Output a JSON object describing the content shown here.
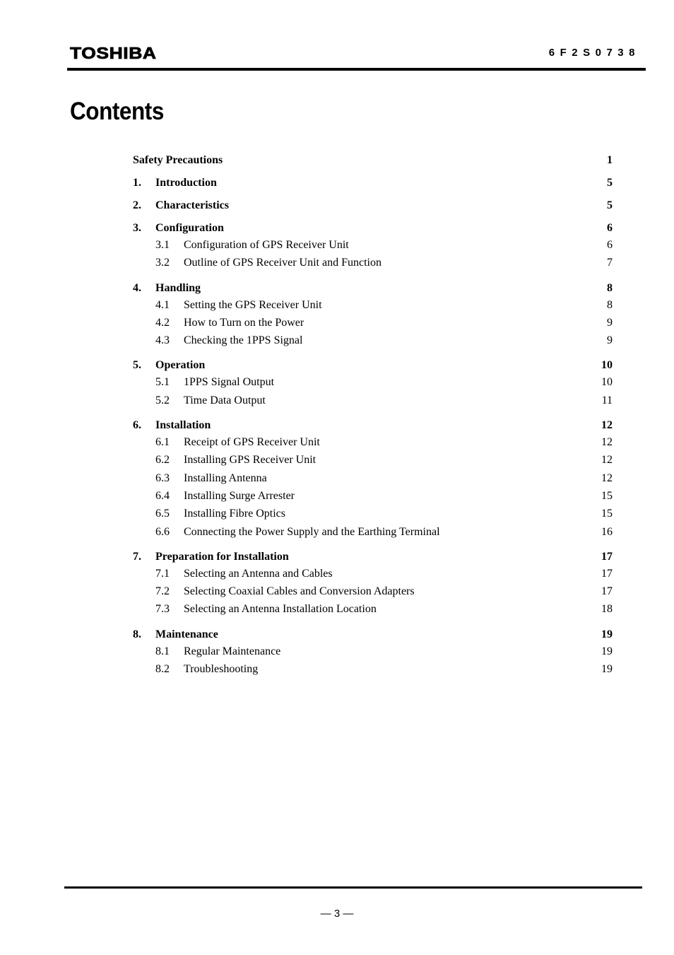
{
  "header": {
    "logo": "TOSHIBA",
    "doc_number": "6F2S0738"
  },
  "title": "Contents",
  "toc": [
    {
      "type": "chapter",
      "num": "",
      "title": "Safety Precautions",
      "page": "1"
    },
    {
      "type": "chapter",
      "num": "1.",
      "title": "Introduction",
      "page": "5"
    },
    {
      "type": "chapter",
      "num": "2.",
      "title": "Characteristics",
      "page": "5"
    },
    {
      "type": "chapter",
      "num": "3.",
      "title": "Configuration",
      "page": "6"
    },
    {
      "type": "section",
      "num": "3.1",
      "title": "Configuration of GPS Receiver Unit",
      "page": "6"
    },
    {
      "type": "section",
      "num": "3.2",
      "title": "Outline of GPS Receiver Unit and Function",
      "page": "7"
    },
    {
      "type": "chapter",
      "num": "4.",
      "title": "Handling",
      "page": "8"
    },
    {
      "type": "section",
      "num": "4.1",
      "title": "Setting the GPS Receiver Unit",
      "page": "8"
    },
    {
      "type": "section",
      "num": "4.2",
      "title": "How to Turn on the Power",
      "page": "9"
    },
    {
      "type": "section",
      "num": "4.3",
      "title": "Checking the 1PPS Signal",
      "page": "9"
    },
    {
      "type": "chapter",
      "num": "5.",
      "title": "Operation",
      "page": "10"
    },
    {
      "type": "section",
      "num": "5.1",
      "title": "1PPS Signal Output",
      "page": "10"
    },
    {
      "type": "section",
      "num": "5.2",
      "title": "Time Data Output",
      "page": "11"
    },
    {
      "type": "chapter",
      "num": "6.",
      "title": "Installation",
      "page": "12"
    },
    {
      "type": "section",
      "num": "6.1",
      "title": "Receipt of GPS Receiver Unit",
      "page": "12"
    },
    {
      "type": "section",
      "num": "6.2",
      "title": "Installing GPS Receiver Unit",
      "page": "12"
    },
    {
      "type": "section",
      "num": "6.3",
      "title": "Installing Antenna",
      "page": "12"
    },
    {
      "type": "section",
      "num": "6.4",
      "title": "Installing Surge Arrester",
      "page": "15"
    },
    {
      "type": "section",
      "num": "6.5",
      "title": "Installing Fibre Optics",
      "page": "15"
    },
    {
      "type": "section",
      "num": "6.6",
      "title": "Connecting the Power Supply and the Earthing Terminal",
      "page": "16"
    },
    {
      "type": "chapter",
      "num": "7.",
      "title": "Preparation for Installation",
      "page": "17"
    },
    {
      "type": "section",
      "num": "7.1",
      "title": "Selecting an Antenna and Cables",
      "page": "17"
    },
    {
      "type": "section",
      "num": "7.2",
      "title": "Selecting Coaxial Cables and Conversion Adapters",
      "page": "17"
    },
    {
      "type": "section",
      "num": "7.3",
      "title": "Selecting an Antenna Installation Location",
      "page": "18"
    },
    {
      "type": "chapter",
      "num": "8.",
      "title": "Maintenance",
      "page": "19"
    },
    {
      "type": "section",
      "num": "8.1",
      "title": "Regular Maintenance",
      "page": "19"
    },
    {
      "type": "section",
      "num": "8.2",
      "title": "Troubleshooting",
      "page": "19"
    }
  ],
  "footer": {
    "page_number": "— 3 —"
  }
}
